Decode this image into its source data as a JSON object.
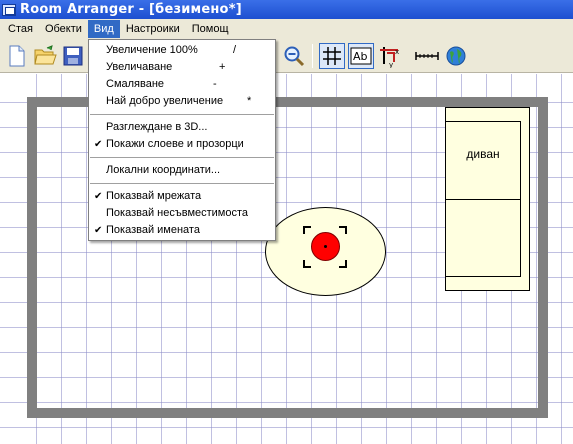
{
  "window": {
    "title": "Room Arranger - [безимено*]"
  },
  "menubar": [
    {
      "label": "Стая",
      "active": false
    },
    {
      "label": "Обекти",
      "active": false
    },
    {
      "label": "Вид",
      "active": true
    },
    {
      "label": "Настроики",
      "active": false
    },
    {
      "label": "Помощ",
      "active": false
    }
  ],
  "toolbar": {
    "icons": [
      "new-file-icon",
      "open-folder-icon",
      "save-icon",
      "zoom-out-icon",
      "grid-icon",
      "labels-icon",
      "coordinates-icon",
      "measure-icon",
      "globe-icon"
    ]
  },
  "view_menu": {
    "items": [
      {
        "label": "Увеличение 100%",
        "shortcut": "/",
        "checked": false
      },
      {
        "label": "Увеличаване",
        "shortcut": "+",
        "checked": false
      },
      {
        "label": "Смаляване",
        "shortcut": "-",
        "checked": false
      },
      {
        "label": "Най добро увеличение",
        "shortcut": "*",
        "checked": false
      },
      {
        "label": "Разглеждане в 3D...",
        "shortcut": "",
        "checked": false
      },
      {
        "label": "Покажи слоеве и прозорци",
        "shortcut": "",
        "checked": true
      },
      {
        "label": "Локални координати...",
        "shortcut": "",
        "checked": false
      },
      {
        "label": "Показвай мрежата",
        "shortcut": "",
        "checked": true
      },
      {
        "label": "Показвай несъвместимоста",
        "shortcut": "",
        "checked": false
      },
      {
        "label": "Показвай имената",
        "shortcut": "",
        "checked": true
      }
    ]
  },
  "canvas": {
    "sofa_label": "диван",
    "colors": {
      "wall": "#808080",
      "furniture_fill": "#ffffe0",
      "selected_object": "#ff0000",
      "grid": "#8c8cc8"
    }
  }
}
